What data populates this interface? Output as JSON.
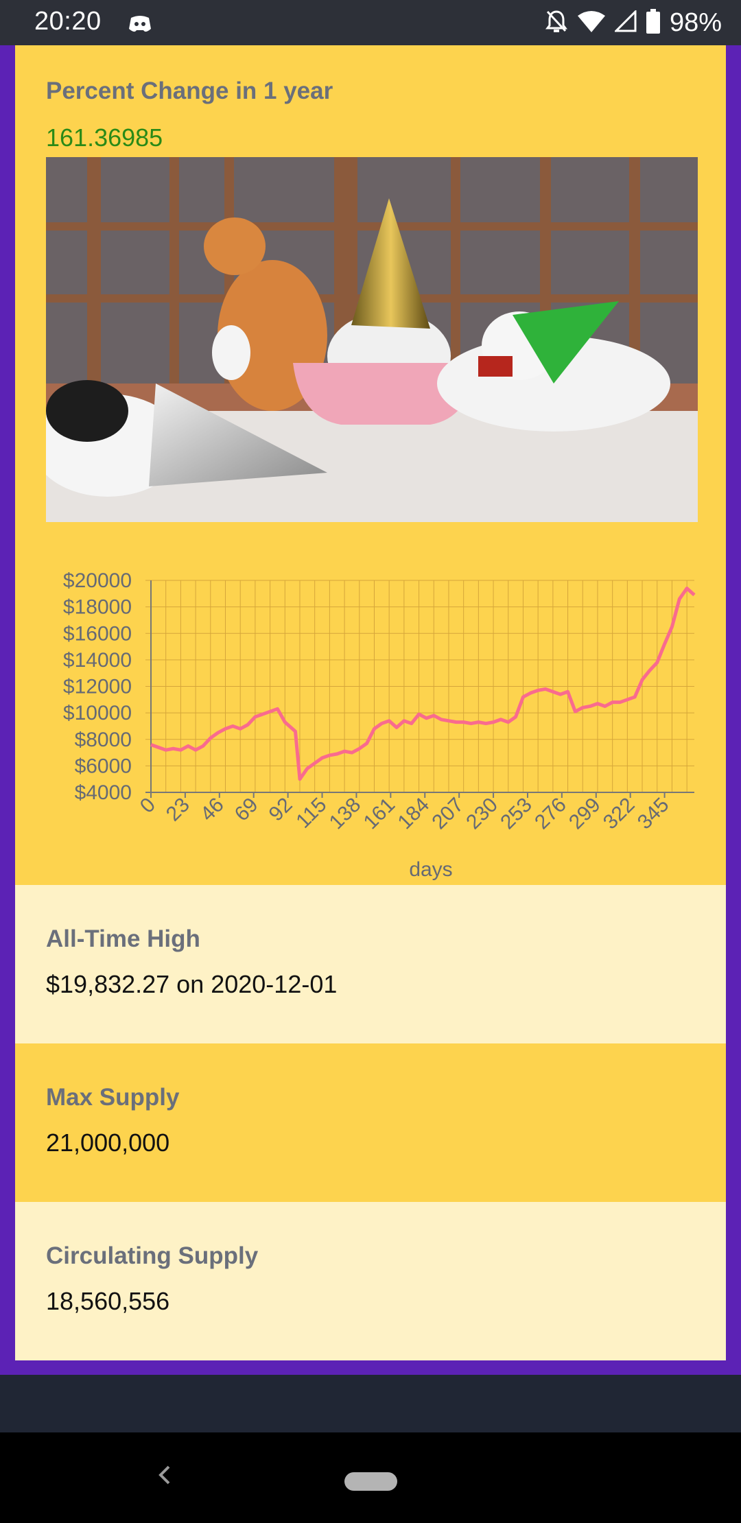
{
  "status_bar": {
    "time": "20:20",
    "battery": "98%",
    "icons": [
      "discord-icon",
      "bell-off-icon",
      "wifi-icon",
      "signal-icon",
      "battery-icon"
    ]
  },
  "percent_change": {
    "label": "Percent Change in 1 year",
    "value": "161.36985",
    "value_color": "#2a8a17"
  },
  "image": {
    "description_icon": "celebration-cats-photo"
  },
  "chart_data": {
    "type": "line",
    "xlabel": "days",
    "ylabel": "",
    "xlim": [
      0,
      365
    ],
    "ylim": [
      4000,
      20000
    ],
    "x_ticks": [
      0,
      23,
      46,
      69,
      92,
      115,
      138,
      161,
      184,
      207,
      230,
      253,
      276,
      299,
      322,
      345
    ],
    "x_tick_labels": [
      "0",
      "23",
      "46",
      "69",
      "92",
      "115",
      "138",
      "161",
      "184",
      "207",
      "230",
      "253",
      "276",
      "299",
      "322",
      "345"
    ],
    "y_ticks": [
      4000,
      6000,
      8000,
      10000,
      12000,
      14000,
      16000,
      18000,
      20000
    ],
    "y_tick_labels": [
      "$4000",
      "$6000",
      "$8000",
      "$10000",
      "$12000",
      "$14000",
      "$16000",
      "$18000",
      "$20000"
    ],
    "grid": true,
    "line_color": "#f96b8e",
    "series": [
      {
        "x": [
          0,
          5,
          10,
          15,
          20,
          25,
          30,
          35,
          40,
          45,
          50,
          55,
          60,
          65,
          70,
          75,
          80,
          85,
          90,
          95,
          97,
          100,
          105,
          110,
          115,
          120,
          125,
          130,
          135,
          140,
          145,
          150,
          155,
          160,
          165,
          170,
          175,
          180,
          185,
          190,
          195,
          200,
          205,
          210,
          215,
          220,
          225,
          230,
          235,
          240,
          245,
          250,
          255,
          260,
          265,
          270,
          275,
          280,
          285,
          290,
          295,
          300,
          305,
          310,
          315,
          320,
          325,
          330,
          335,
          340,
          345,
          350,
          355,
          360,
          365
        ],
        "y": [
          7600,
          7400,
          7200,
          7300,
          7200,
          7500,
          7200,
          7500,
          8100,
          8500,
          8800,
          9000,
          8800,
          9100,
          9700,
          9900,
          10100,
          10300,
          9300,
          8800,
          8600,
          5000,
          5800,
          6200,
          6600,
          6800,
          6900,
          7100,
          7000,
          7300,
          7700,
          8800,
          9200,
          9400,
          8900,
          9400,
          9200,
          9900,
          9600,
          9800,
          9500,
          9400,
          9300,
          9300,
          9200,
          9300,
          9200,
          9300,
          9500,
          9300,
          9700,
          11200,
          11500,
          11700,
          11800,
          11600,
          11400,
          11600,
          10100,
          10400,
          10500,
          10700,
          10500,
          10800,
          10800,
          11000,
          11200,
          12500,
          13200,
          13800,
          15200,
          16500,
          18600,
          19400,
          18900
        ]
      }
    ]
  },
  "all_time_high": {
    "label": "All-Time High",
    "value": "$19,832.27 on 2020-12-01"
  },
  "max_supply": {
    "label": "Max Supply",
    "value": "21,000,000"
  },
  "circulating_supply": {
    "label": "Circulating Supply",
    "value": "18,560,556"
  },
  "colors": {
    "frame": "#5c22b5",
    "card_yellow": "#fdd34e",
    "card_cream": "#fef2c6",
    "label_gray": "#6a6f7b"
  }
}
